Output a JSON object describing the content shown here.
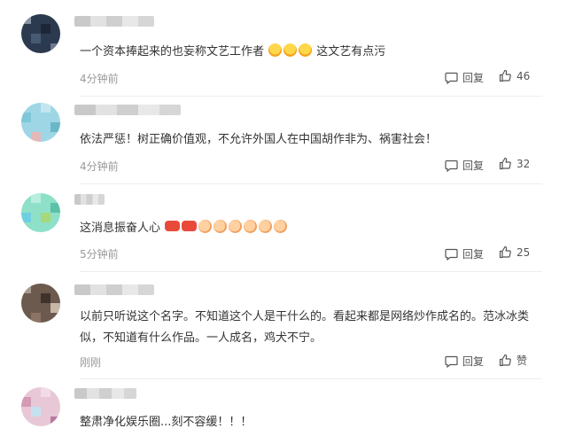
{
  "labels": {
    "reply": "回复"
  },
  "comments": [
    {
      "text": "一个资本捧起来的也妄称文艺工作者",
      "suffix": "这文艺有点污",
      "time": "4分钟前",
      "likes": "46"
    },
    {
      "text": "依法严惩！树正确价值观，不允许外国人在中国胡作非为、祸害社会！",
      "time": "4分钟前",
      "likes": "32"
    },
    {
      "text": "这消息振奋人心",
      "time": "5分钟前",
      "likes": "25"
    },
    {
      "text": "以前只听说这个名字。不知道这个人是干什么的。看起来都是网络炒作成名的。范冰冰类似，不知道有什么作品。一人成名，鸡犬不宁。",
      "time": "刚刚",
      "likes": "赞"
    },
    {
      "text": "整肃净化娱乐圈...刻不容缓！！！"
    }
  ],
  "colors": {
    "text": "#333333",
    "meta": "#999999",
    "divider": "#eeeeee"
  }
}
